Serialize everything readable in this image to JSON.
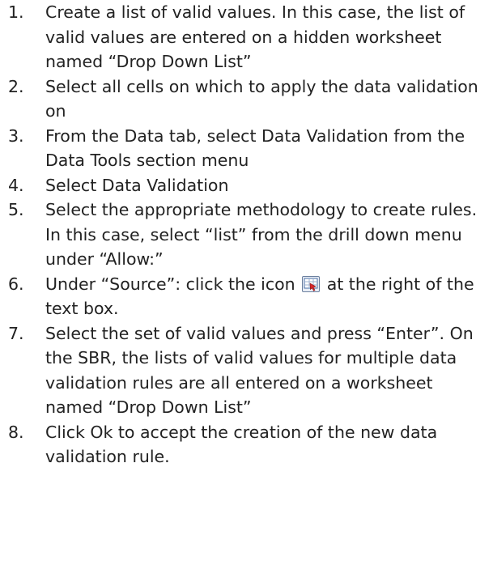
{
  "steps": [
    {
      "number": "1.",
      "text": "Create a list of valid values.  In this case, the list of valid values are entered on a hidden worksheet named “Drop Down List”"
    },
    {
      "number": "2.",
      "text": "Select all cells on which to apply the data validation on"
    },
    {
      "number": "3.",
      "text": "From the Data tab, select Data Validation from the Data Tools section menu"
    },
    {
      "number": "4.",
      "text": "Select Data Validation"
    },
    {
      "number": "5.",
      "text": "Select the appropriate methodology to create rules.  In this case, select “list” from the drill down menu under “Allow:”"
    },
    {
      "number": "6.",
      "text_before_icon": "Under “Source”: click the icon",
      "icon": "range-selector-icon",
      "text_after_icon": "at the right of the text box."
    },
    {
      "number": "7.",
      "text": "Select the set of valid values and press “Enter”.  On the SBR, the lists of valid values for multiple data validation rules are all entered on a worksheet named “Drop Down List”"
    },
    {
      "number": "8.",
      "text": "Click Ok to accept the creation of the new data validation rule."
    }
  ]
}
